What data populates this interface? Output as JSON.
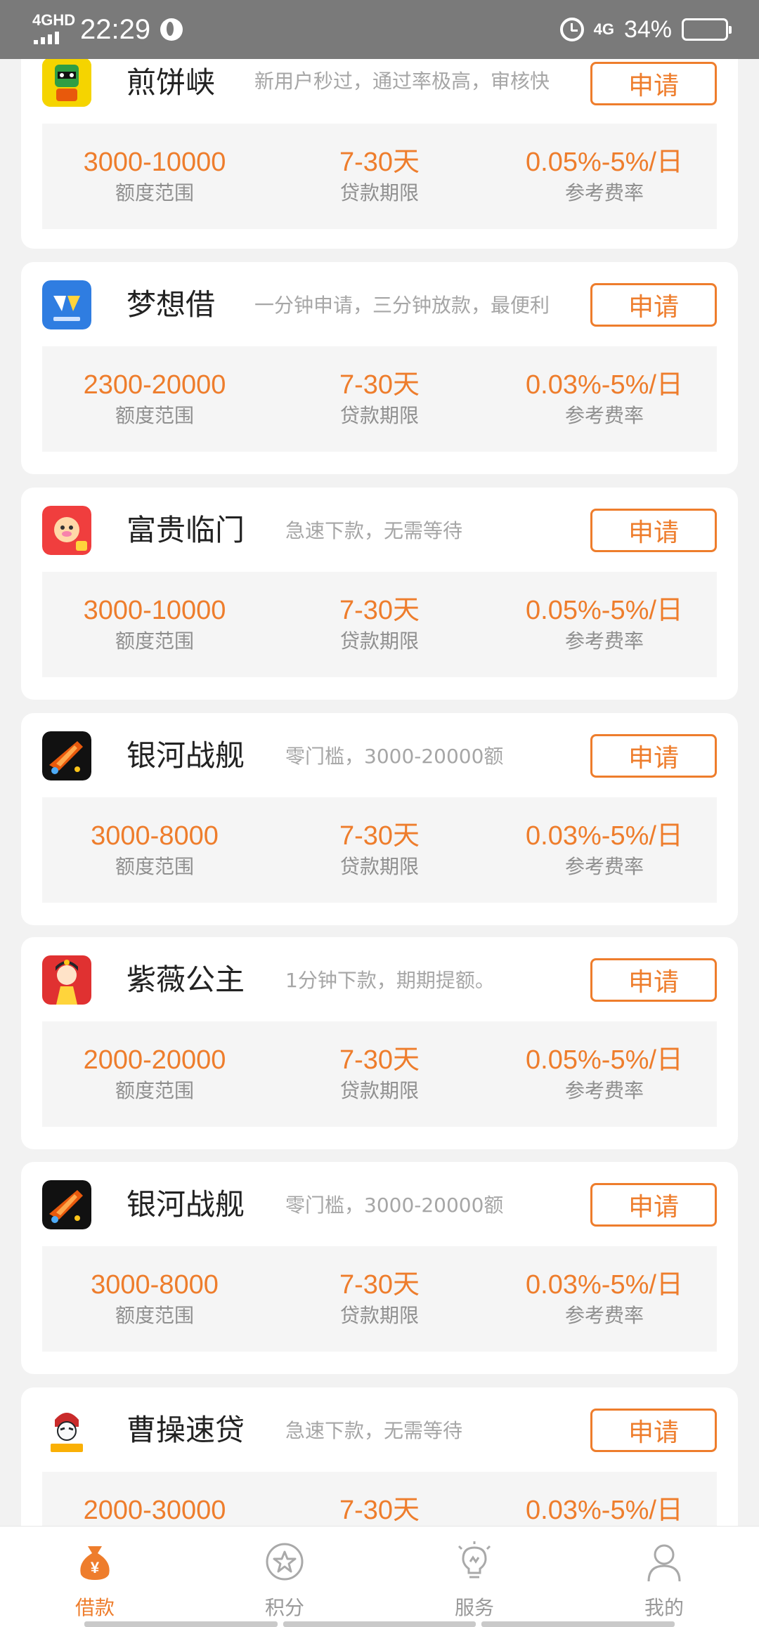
{
  "status_bar": {
    "network": "4GHD",
    "time": "22:29",
    "net2": "4G",
    "battery": "34%",
    "battery_level": 0.34
  },
  "colors": {
    "accent": "#ee7d2c",
    "label": "#8f8f8f",
    "desc": "#a6a6a6"
  },
  "apply_label": "申请",
  "stat_labels": {
    "amount": "额度范围",
    "term": "贷款期限",
    "rate": "参考费率"
  },
  "cards": [
    {
      "name": "煎饼峡",
      "desc": "新用户秒过，通过率极高，审核快",
      "amount": "3000-10000",
      "term": "7-30天",
      "rate": "0.05%-5%/日",
      "logo_icon": "robot-logo-icon"
    },
    {
      "name": "梦想借",
      "desc": "一分钟申请，三分钟放款，最便利",
      "amount": "2300-20000",
      "term": "7-30天",
      "rate": "0.03%-5%/日",
      "logo_icon": "dream-logo-icon"
    },
    {
      "name": "富贵临门",
      "desc": "急速下款，无需等待",
      "amount": "3000-10000",
      "term": "7-30天",
      "rate": "0.05%-5%/日",
      "logo_icon": "pig-logo-icon"
    },
    {
      "name": "银河战舰",
      "desc": "零门槛，3000-20000额",
      "amount": "3000-8000",
      "term": "7-30天",
      "rate": "0.03%-5%/日",
      "logo_icon": "ship-logo-icon"
    },
    {
      "name": "紫薇公主",
      "desc": "1分钟下款，期期提额。",
      "amount": "2000-20000",
      "term": "7-30天",
      "rate": "0.05%-5%/日",
      "logo_icon": "princess-logo-icon"
    },
    {
      "name": "银河战舰",
      "desc": "零门槛，3000-20000额",
      "amount": "3000-8000",
      "term": "7-30天",
      "rate": "0.03%-5%/日",
      "logo_icon": "ship-logo-icon"
    },
    {
      "name": "曹操速贷",
      "desc": "急速下款，无需等待",
      "amount": "2000-30000",
      "term": "7-30天",
      "rate": "0.03%-5%/日",
      "logo_icon": "caocao-logo-icon"
    }
  ],
  "nav": [
    {
      "label": "借款",
      "icon": "money-bag-icon",
      "active": true
    },
    {
      "label": "积分",
      "icon": "star-circle-icon",
      "active": false
    },
    {
      "label": "服务",
      "icon": "lightbulb-icon",
      "active": false
    },
    {
      "label": "我的",
      "icon": "person-icon",
      "active": false
    }
  ]
}
